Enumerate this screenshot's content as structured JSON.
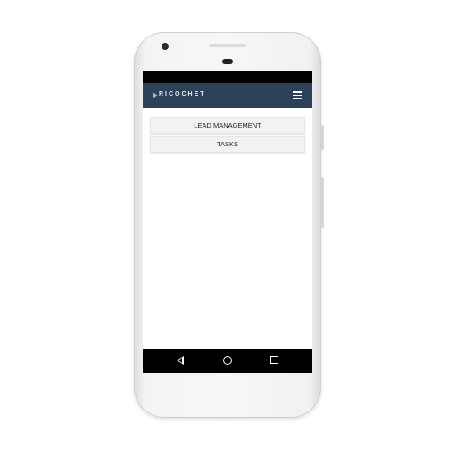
{
  "app": {
    "logo_text": "RICOCHET",
    "colors": {
      "app_bar": "#2d4159",
      "button_bg": "#f2f2f2"
    }
  },
  "icons": {
    "menu": "hamburger-menu-icon",
    "back": "back-icon",
    "home": "home-icon",
    "recents": "recents-icon"
  },
  "main": {
    "buttons": [
      {
        "label": "LEAD MANAGEMENT"
      },
      {
        "label": "TASKS"
      }
    ]
  }
}
